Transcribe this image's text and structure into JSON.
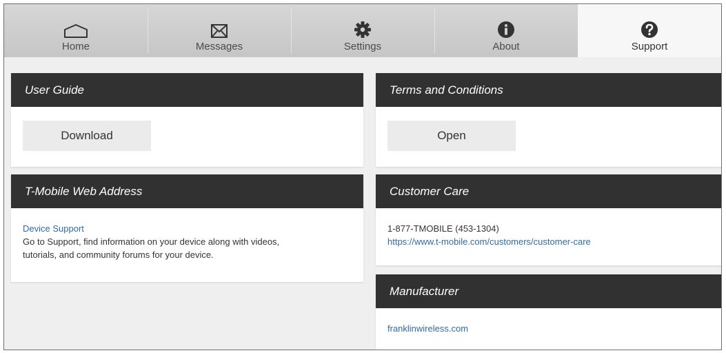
{
  "tabs": [
    {
      "label": "Home",
      "icon": "home-icon"
    },
    {
      "label": "Messages",
      "icon": "envelope-icon"
    },
    {
      "label": "Settings",
      "icon": "gear-icon"
    },
    {
      "label": "About",
      "icon": "info-icon"
    },
    {
      "label": "Support",
      "icon": "question-icon",
      "active": true
    }
  ],
  "user_guide": {
    "title": "User Guide",
    "button": "Download"
  },
  "terms": {
    "title": "Terms and Conditions",
    "button": "Open"
  },
  "web_address": {
    "title": "T-Mobile Web Address",
    "link": "Device Support",
    "description_line1": "Go to Support, find information on your device along with videos,",
    "description_line2": "tutorials, and community forums for your device."
  },
  "customer_care": {
    "title": "Customer Care",
    "phone": "1-877-TMOBILE (453-1304)",
    "link": "https://www.t-mobile.com/customers/customer-care"
  },
  "manufacturer": {
    "title": "Manufacturer",
    "link": "franklinwireless.com"
  },
  "colors": {
    "header_bg": "#313131",
    "link": "#2f6ba8",
    "tab_bg": "#c9c9c9",
    "page_bg": "#efefef"
  }
}
